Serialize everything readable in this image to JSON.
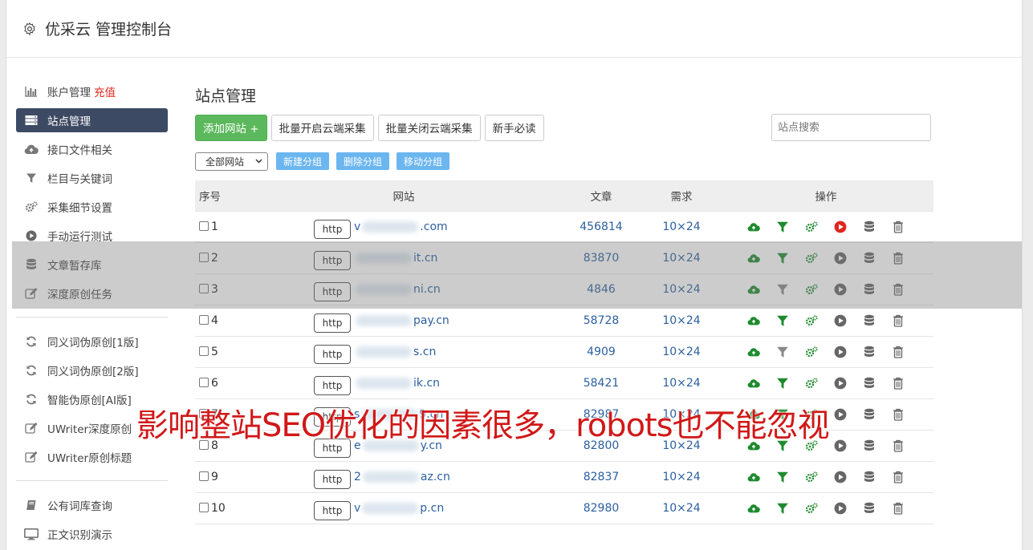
{
  "header": {
    "title": "优采云 管理控制台"
  },
  "sidebar": {
    "group1": [
      {
        "label": "账户管理",
        "extra": "充值",
        "icon": "bar-chart-icon"
      },
      {
        "label": "站点管理",
        "icon": "server-icon",
        "active": true
      },
      {
        "label": "接口文件相关",
        "icon": "cloud-upload-icon"
      },
      {
        "label": "栏目与关键词",
        "icon": "filter-icon"
      },
      {
        "label": "采集细节设置",
        "icon": "gears-icon"
      },
      {
        "label": "手动运行测试",
        "icon": "play-circle-icon"
      },
      {
        "label": "文章暂存库",
        "icon": "database-icon"
      },
      {
        "label": "深度原创任务",
        "icon": "edit-icon"
      }
    ],
    "group2": [
      {
        "label": "同义词伪原创[1版]",
        "icon": "refresh-icon"
      },
      {
        "label": "同义词伪原创[2版]",
        "icon": "refresh-icon"
      },
      {
        "label": "智能伪原创[AI版]",
        "icon": "refresh-icon"
      },
      {
        "label": "UWriter深度原创",
        "icon": "edit-icon"
      },
      {
        "label": "UWriter原创标题",
        "icon": "edit-icon"
      }
    ],
    "group3": [
      {
        "label": "公有词库查询",
        "icon": "book-icon"
      },
      {
        "label": "正文识别演示",
        "icon": "monitor-icon"
      }
    ]
  },
  "main": {
    "title": "站点管理",
    "toolbar": {
      "add_site": "添加网站 +",
      "batch_open": "批量开启云端采集",
      "batch_close": "批量关闭云端采集",
      "newbie": "新手必读",
      "search_placeholder": "站点搜索"
    },
    "group_select": "全部网站",
    "group_buttons": {
      "new": "新建分组",
      "delete": "删除分组",
      "move": "移动分组"
    },
    "table": {
      "headers": {
        "no": "序号",
        "site": "网站",
        "articles": "文章",
        "demand": "需求",
        "ops": "操作"
      },
      "rows": [
        {
          "no": "1",
          "protocol": "http",
          "prefix": "v",
          "suffix": ".com",
          "articles": "456814",
          "demand": "10×24",
          "play_active": true
        },
        {
          "no": "2",
          "protocol": "http",
          "prefix": "",
          "suffix": "it.cn",
          "articles": "83870",
          "demand": "10×24",
          "play_active": false
        },
        {
          "no": "3",
          "protocol": "http",
          "prefix": "",
          "suffix": "ni.cn",
          "articles": "4846",
          "demand": "10×24",
          "play_active": false,
          "filter_gray": true
        },
        {
          "no": "4",
          "protocol": "http",
          "prefix": "",
          "suffix": "pay.cn",
          "articles": "58728",
          "demand": "10×24",
          "play_active": false
        },
        {
          "no": "5",
          "protocol": "http",
          "prefix": "",
          "suffix": "s.cn",
          "articles": "4909",
          "demand": "10×24",
          "play_active": false,
          "filter_gray": true
        },
        {
          "no": "6",
          "protocol": "http",
          "prefix": "",
          "suffix": "ik.cn",
          "articles": "58421",
          "demand": "10×24",
          "play_active": false
        },
        {
          "no": "7",
          "protocol": "http",
          "prefix": "s",
          "suffix": "9.cn",
          "articles": "82987",
          "demand": "10×24",
          "play_active": false
        },
        {
          "no": "8",
          "protocol": "http",
          "prefix": "e",
          "suffix": "y.cn",
          "articles": "82800",
          "demand": "10×24",
          "play_active": false
        },
        {
          "no": "9",
          "protocol": "http",
          "prefix": "2",
          "suffix": "az.cn",
          "articles": "82837",
          "demand": "10×24",
          "play_active": false
        },
        {
          "no": "10",
          "protocol": "http",
          "prefix": "v",
          "suffix": "p.cn",
          "articles": "82980",
          "demand": "10×24",
          "play_active": false
        }
      ]
    }
  },
  "overlay_caption": "影响整站SEO优化的因素很多，robots也不能忽视",
  "colors": {
    "sidebar_active": "#3d4a63",
    "green": "#5cb85c",
    "blue_btn": "#6cb6f0",
    "link": "#2b5f9f",
    "caption": "#d11818",
    "op_green": "#1e8a2e",
    "op_red": "#e0261e"
  }
}
